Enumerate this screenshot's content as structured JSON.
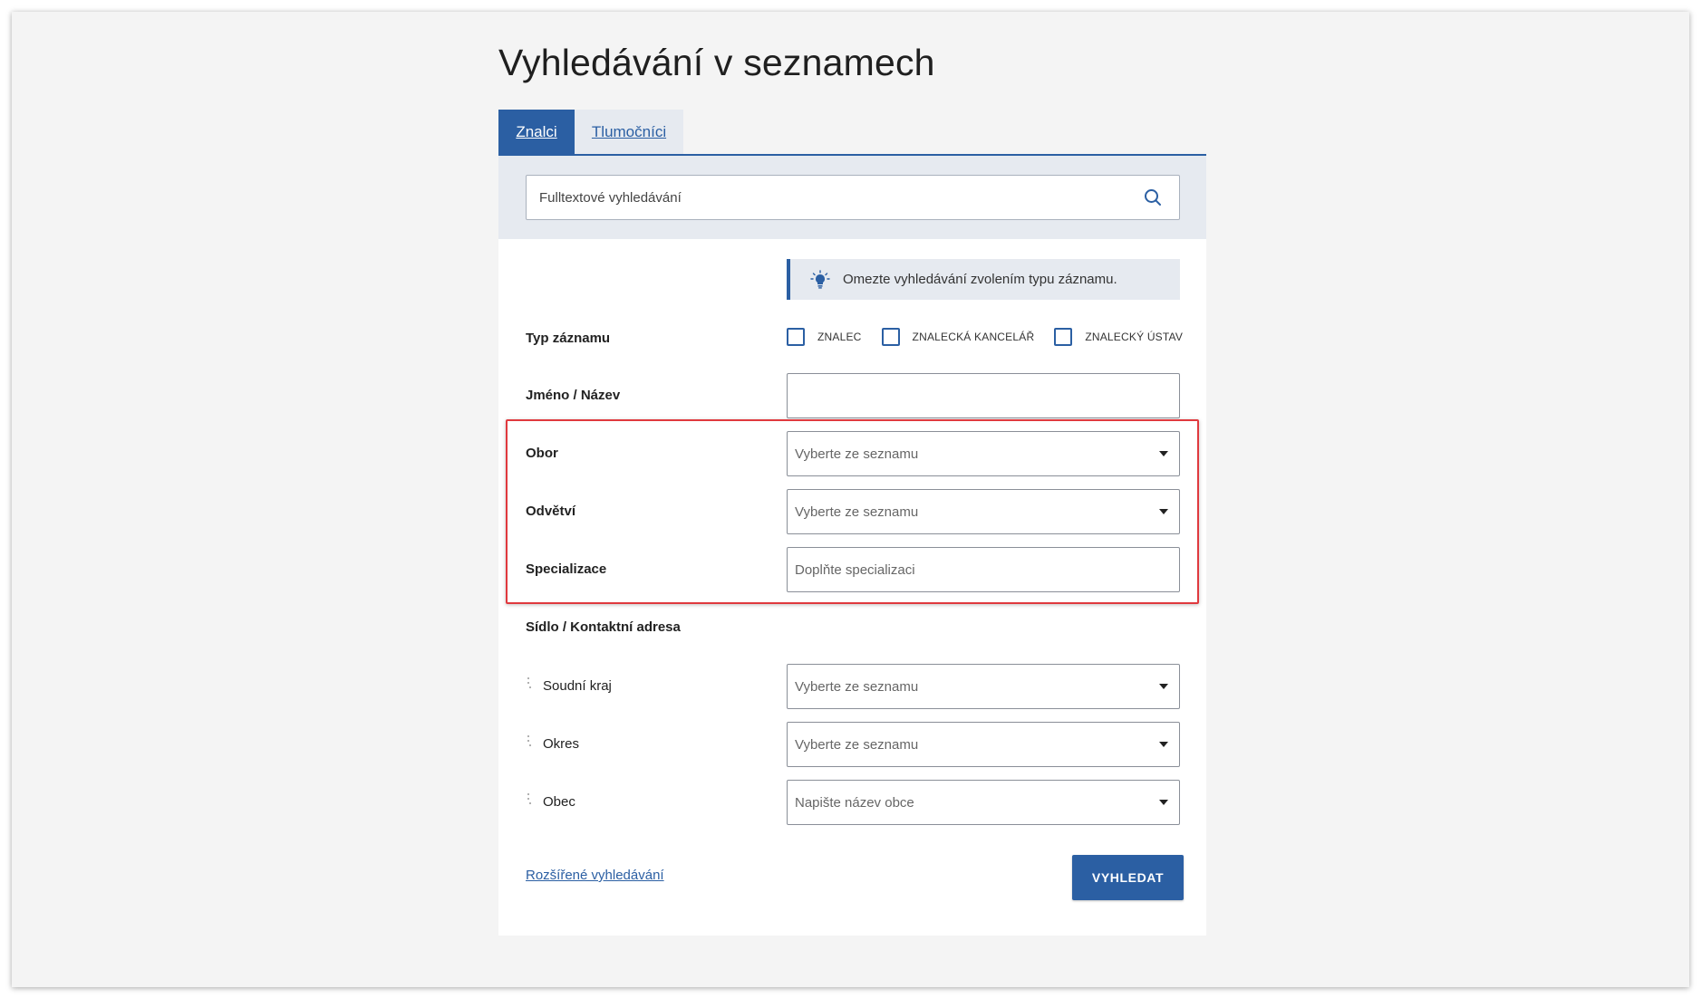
{
  "page": {
    "title": "Vyhledávání v seznamech"
  },
  "tabs": [
    {
      "label": "Znalci",
      "active": true
    },
    {
      "label": "Tlumočníci",
      "active": false
    }
  ],
  "search": {
    "placeholder": "Fulltextové vyhledávání",
    "icon": "search-icon"
  },
  "hint": {
    "icon": "lightbulb-icon",
    "text": "Omezte vyhledávání zvolením typu záznamu."
  },
  "record_type": {
    "label": "Typ záznamu",
    "options": [
      {
        "label": "ZNALEC",
        "checked": false
      },
      {
        "label": "ZNALECKÁ KANCELÁŘ",
        "checked": false
      },
      {
        "label": "ZNALECKÝ ÚSTAV",
        "checked": false
      }
    ]
  },
  "fields": {
    "name": {
      "label": "Jméno / Název",
      "value": ""
    },
    "obor": {
      "label": "Obor",
      "placeholder": "Vyberte ze seznamu"
    },
    "odvetvi": {
      "label": "Odvětví",
      "placeholder": "Vyberte ze seznamu"
    },
    "specializace": {
      "label": "Specializace",
      "placeholder": "Doplňte specializaci"
    }
  },
  "address": {
    "label": "Sídlo / Kontaktní adresa",
    "soudni_kraj": {
      "label": "Soudní kraj",
      "placeholder": "Vyberte ze seznamu"
    },
    "okres": {
      "label": "Okres",
      "placeholder": "Vyberte ze seznamu"
    },
    "obec": {
      "label": "Obec",
      "placeholder": "Napište název obce"
    }
  },
  "actions": {
    "advanced_link": "Rozšířené vyhledávání",
    "submit": "VYHLEDAT"
  },
  "colors": {
    "primary": "#2b5fa3",
    "band": "#e6eaf0",
    "highlight": "#e0393e"
  }
}
